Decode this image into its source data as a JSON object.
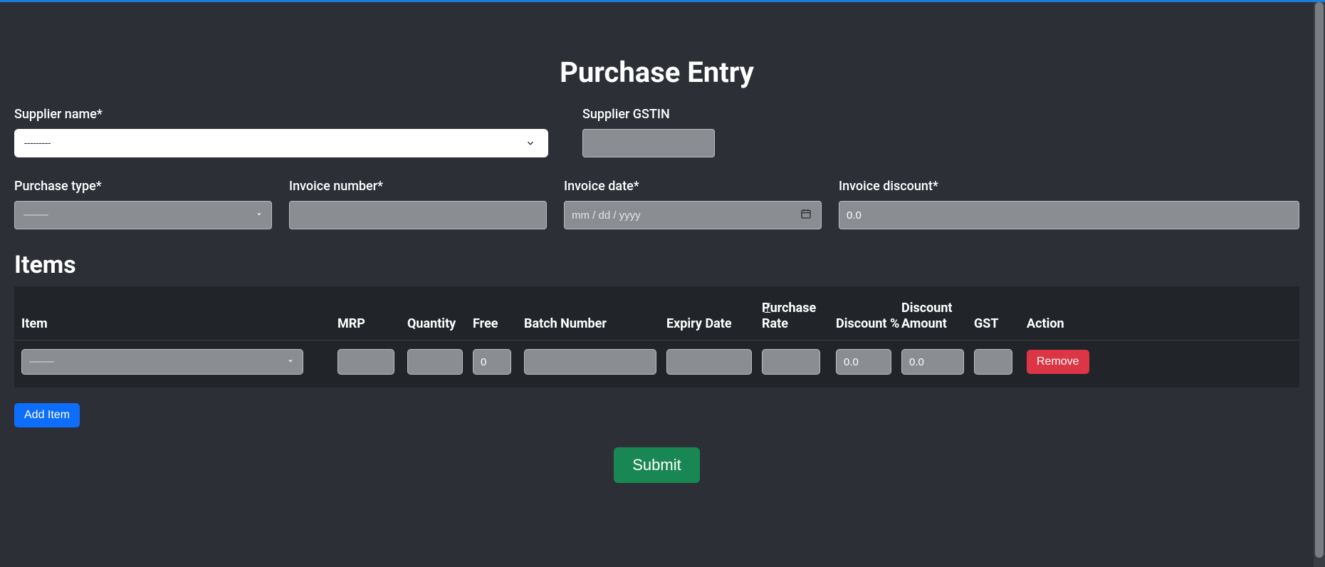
{
  "page": {
    "title": "Purchase Entry",
    "items_heading": "Items"
  },
  "labels": {
    "supplier_name": "Supplier name*",
    "supplier_gstin": "Supplier GSTIN",
    "purchase_type": "Purchase type*",
    "invoice_number": "Invoice number*",
    "invoice_date": "Invoice date*",
    "invoice_discount": "Invoice discount*"
  },
  "values": {
    "supplier_name_selected": "---------",
    "supplier_gstin": "",
    "purchase_type_selected": "---------",
    "invoice_number": "",
    "invoice_date_placeholder": "mm / dd / yyyy",
    "invoice_discount": "0.0"
  },
  "columns": {
    "item": "Item",
    "mrp": "MRP",
    "quantity": "Quantity",
    "free": "Free",
    "batch": "Batch Number",
    "expiry": "Expiry Date",
    "rate": "Purchase Rate",
    "disc_pct": "Discount %",
    "disc_amt": "Discount Amount",
    "gst": "GST",
    "action": "Action"
  },
  "rows": [
    {
      "item_selected": "---------",
      "mrp": "",
      "quantity": "",
      "free": "0",
      "batch": "",
      "expiry": "",
      "rate": "",
      "disc_pct": "0.0",
      "disc_amt": "0.0",
      "gst": ""
    }
  ],
  "buttons": {
    "remove": "Remove",
    "add_item": "Add Item",
    "submit": "Submit"
  }
}
